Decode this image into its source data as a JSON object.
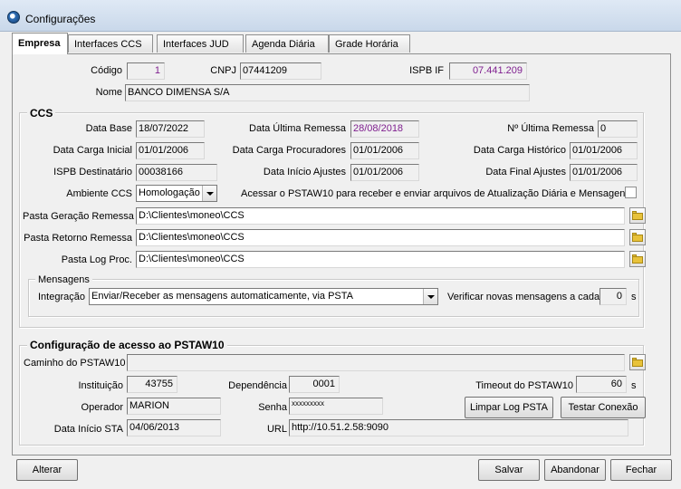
{
  "window": {
    "title": "Configurações"
  },
  "tabs": [
    "Empresa",
    "Interfaces CCS",
    "Interfaces JUD",
    "Agenda Diária",
    "Grade Horária"
  ],
  "empresa": {
    "codigo_label": "Código",
    "codigo": "1",
    "cnpj_label": "CNPJ",
    "cnpj": "07441209",
    "ispb_if_label": "ISPB IF",
    "ispb_if": "07.441.209",
    "nome_label": "Nome",
    "nome": "BANCO DIMENSA S/A"
  },
  "ccs": {
    "title": "CCS",
    "data_base_label": "Data Base",
    "data_base": "18/07/2022",
    "data_ultima_remessa_label": "Data Última Remessa",
    "data_ultima_remessa": "28/08/2018",
    "n_ultima_remessa_label": "Nº Última Remessa",
    "n_ultima_remessa": "0",
    "data_carga_inicial_label": "Data Carga Inicial",
    "data_carga_inicial": "01/01/2006",
    "data_carga_procuradores_label": "Data Carga Procuradores",
    "data_carga_procuradores": "01/01/2006",
    "data_carga_historico_label": "Data Carga Histórico",
    "data_carga_historico": "01/01/2006",
    "ispb_destinatario_label": "ISPB Destinatário",
    "ispb_destinatario": "00038166",
    "data_inicio_ajustes_label": "Data Início Ajustes",
    "data_inicio_ajustes": "01/01/2006",
    "data_final_ajustes_label": "Data Final Ajustes",
    "data_final_ajustes": "01/01/2006",
    "ambiente_label": "Ambiente CCS",
    "ambiente": "Homologação",
    "acessar_label": "Acessar o PSTAW10 para receber e enviar arquivos de Atualização Diária e Mensagens",
    "pasta_geracao_label": "Pasta Geração Remessa",
    "pasta_geracao": "D:\\Clientes\\moneo\\CCS",
    "pasta_retorno_label": "Pasta Retorno Remessa",
    "pasta_retorno": "D:\\Clientes\\moneo\\CCS",
    "pasta_log_label": "Pasta Log Proc.",
    "pasta_log": "D:\\Clientes\\moneo\\CCS",
    "mensagens": {
      "title": "Mensagens",
      "integracao_label": "Integração",
      "integracao": "Enviar/Receber as mensagens automaticamente, via PSTA",
      "verificar_label": "Verificar novas mensagens a cada",
      "verificar": "0",
      "unit": "s"
    }
  },
  "pstaw10": {
    "title": "Configuração de acesso ao PSTAW10",
    "caminho_label": "Caminho do PSTAW10",
    "caminho": "",
    "instituicao_label": "Instituição",
    "instituicao": "43755",
    "dependencia_label": "Dependência",
    "dependencia": "0001",
    "timeout_label": "Timeout do PSTAW10",
    "timeout": "60",
    "timeout_unit": "s",
    "operador_label": "Operador",
    "operador": "MARION",
    "senha_label": "Senha",
    "senha": "xxxxxxxxx",
    "data_inicio_sta_label": "Data Início STA",
    "data_inicio_sta": "04/06/2013",
    "url_label": "URL",
    "url": "http://10.51.2.58:9090",
    "limpar_log": "Limpar Log PSTA",
    "testar_conexao": "Testar Conexão"
  },
  "buttons": {
    "alterar": "Alterar",
    "salvar": "Salvar",
    "abandonar": "Abandonar",
    "fechar": "Fechar"
  }
}
